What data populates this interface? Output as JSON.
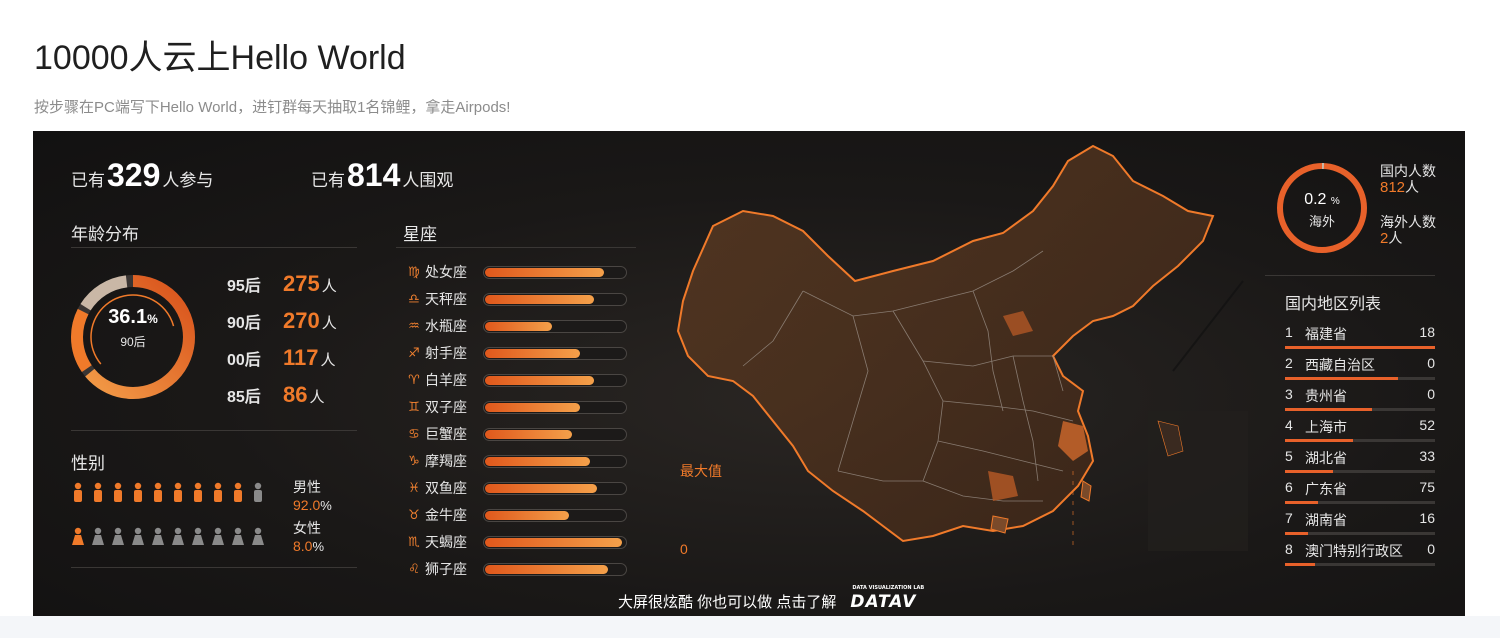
{
  "page": {
    "title": "10000人云上Hello World",
    "subtitle": "按步骤在PC端写下Hello World，进钉群每天抽取1名锦鲤，拿走Airpods!"
  },
  "stats": {
    "participants_prefix": "已有",
    "participants": "329",
    "participants_suffix": "人参与",
    "viewers_prefix": "已有",
    "viewers": "814",
    "viewers_suffix": "人围观"
  },
  "age": {
    "title": "年龄分布",
    "center_pct": "36.1",
    "center_pct_unit": "%",
    "center_label": "90后",
    "unit": "人",
    "rows": [
      {
        "label": "95后",
        "value": "275"
      },
      {
        "label": "90后",
        "value": "270"
      },
      {
        "label": "00后",
        "value": "117"
      },
      {
        "label": "85后",
        "value": "86"
      }
    ]
  },
  "gender": {
    "title": "性别",
    "male_label": "男性",
    "male_pct": "92.0",
    "female_label": "女性",
    "female_pct": "8.0",
    "pct_unit": "%",
    "male_icons_filled": 9,
    "female_icons_filled": 1,
    "icons_total": 10
  },
  "zodiac": {
    "title": "星座",
    "items": [
      {
        "symbol": "♍",
        "name": "处女座",
        "level": 0.85
      },
      {
        "symbol": "♎",
        "name": "天秤座",
        "level": 0.78
      },
      {
        "symbol": "♒",
        "name": "水瓶座",
        "level": 0.48
      },
      {
        "symbol": "♐",
        "name": "射手座",
        "level": 0.68
      },
      {
        "symbol": "♈",
        "name": "白羊座",
        "level": 0.78
      },
      {
        "symbol": "♊",
        "name": "双子座",
        "level": 0.68
      },
      {
        "symbol": "♋",
        "name": "巨蟹座",
        "level": 0.62
      },
      {
        "symbol": "♑",
        "name": "摩羯座",
        "level": 0.75
      },
      {
        "symbol": "♓",
        "name": "双鱼座",
        "level": 0.8
      },
      {
        "symbol": "♉",
        "name": "金牛座",
        "level": 0.6
      },
      {
        "symbol": "♏",
        "name": "天蝎座",
        "level": 0.98
      },
      {
        "symbol": "♌",
        "name": "狮子座",
        "level": 0.88
      }
    ]
  },
  "map": {
    "max_label": "最大值",
    "min_label": "0"
  },
  "overseas": {
    "pct": "0.2",
    "pct_unit": "%",
    "label": "海外",
    "domestic_label": "国内人数",
    "domestic_value": "812",
    "overseas_label": "海外人数",
    "overseas_value": "2",
    "unit": "人",
    "ring_fraction": 0.998
  },
  "regions": {
    "title": "国内地区列表",
    "items": [
      {
        "idx": "1",
        "name": "福建省",
        "value": "18",
        "bar": 1.0
      },
      {
        "idx": "2",
        "name": "西藏自治区",
        "value": "0",
        "bar": 0.75
      },
      {
        "idx": "3",
        "name": "贵州省",
        "value": "0",
        "bar": 0.58
      },
      {
        "idx": "4",
        "name": "上海市",
        "value": "52",
        "bar": 0.45
      },
      {
        "idx": "5",
        "name": "湖北省",
        "value": "33",
        "bar": 0.32
      },
      {
        "idx": "6",
        "name": "广东省",
        "value": "75",
        "bar": 0.22
      },
      {
        "idx": "7",
        "name": "湖南省",
        "value": "16",
        "bar": 0.15
      },
      {
        "idx": "8",
        "name": "澳门特别行政区",
        "value": "0",
        "bar": 0.2
      }
    ]
  },
  "footer": {
    "text": "大屏很炫酷 你也可以做 点击了解",
    "logo_small": "DATA VISUALIZATION LAB",
    "logo": "DATAV"
  },
  "colors": {
    "accent": "#f07a2a",
    "panel_bg": "#1a1817",
    "inactive_icon": "#8a8a8a"
  }
}
